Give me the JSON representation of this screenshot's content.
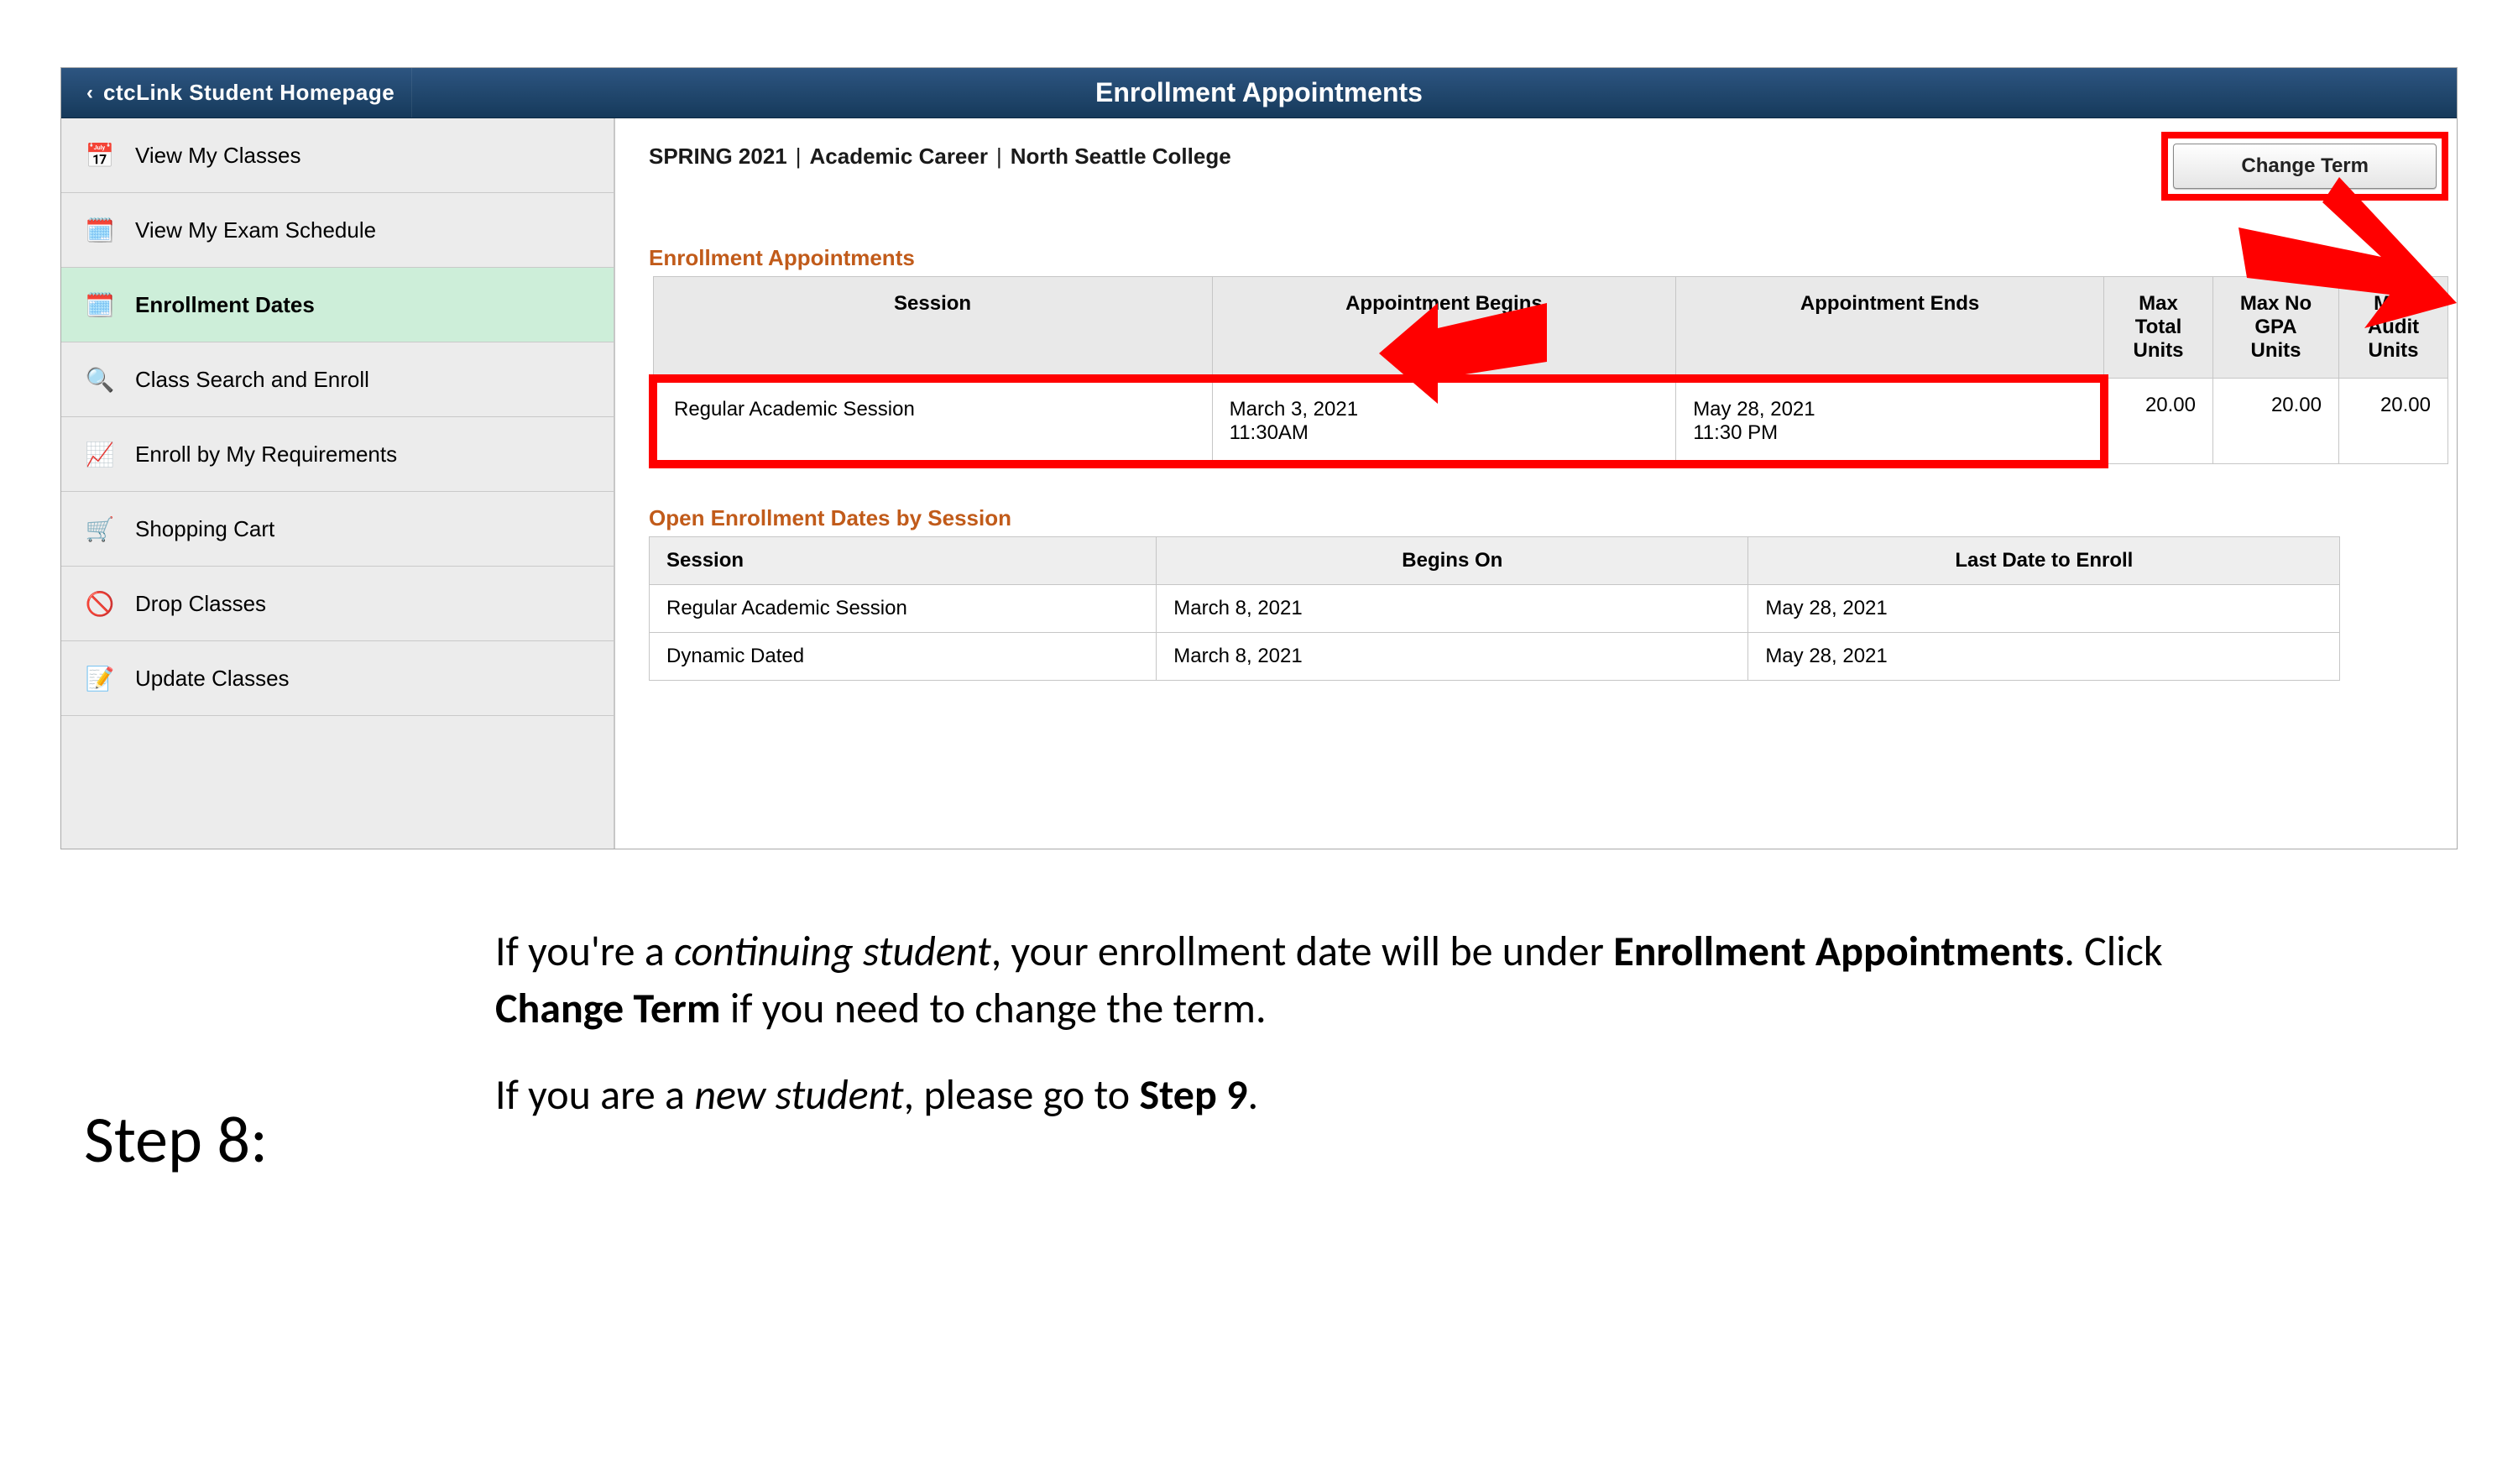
{
  "header": {
    "back_label": "ctcLink Student Homepage",
    "title": "Enrollment Appointments"
  },
  "sidebar": {
    "items": [
      {
        "label": "View My Classes",
        "icon": "📅",
        "name": "sidebar-item-view-my-classes"
      },
      {
        "label": "View My Exam Schedule",
        "icon": "🗓️",
        "name": "sidebar-item-view-my-exam-schedule"
      },
      {
        "label": "Enrollment Dates",
        "icon": "🗓️",
        "name": "sidebar-item-enrollment-dates",
        "active": true
      },
      {
        "label": "Class Search and Enroll",
        "icon": "🔍",
        "name": "sidebar-item-class-search-and-enroll"
      },
      {
        "label": "Enroll by My Requirements",
        "icon": "📈",
        "name": "sidebar-item-enroll-by-my-requirements"
      },
      {
        "label": "Shopping Cart",
        "icon": "🛒",
        "name": "sidebar-item-shopping-cart"
      },
      {
        "label": "Drop Classes",
        "icon": "🚫",
        "name": "sidebar-item-drop-classes"
      },
      {
        "label": "Update Classes",
        "icon": "📝",
        "name": "sidebar-item-update-classes"
      }
    ]
  },
  "term": {
    "code": "SPRING 2021",
    "career": "Academic Career",
    "institution": "North Seattle College",
    "change_button": "Change Term"
  },
  "enrollment_appointments": {
    "title": "Enrollment Appointments",
    "headers": {
      "session": "Session",
      "begins": "Appointment Begins",
      "ends": "Appointment Ends",
      "max_total": "Max Total Units",
      "max_no_gpa": "Max No GPA Units",
      "max_audit": "Max Audit Units"
    },
    "rows": [
      {
        "session": "Regular Academic Session",
        "begins_line1": "March 3, 2021",
        "begins_line2": "11:30AM",
        "ends_line1": "May 28, 2021",
        "ends_line2": "11:30 PM",
        "max_total": "20.00",
        "max_no_gpa": "20.00",
        "max_audit": "20.00"
      }
    ]
  },
  "open_enrollment": {
    "title": "Open Enrollment Dates by Session",
    "headers": {
      "session": "Session",
      "begins": "Begins On",
      "last": "Last Date to Enroll"
    },
    "rows": [
      {
        "session": "Regular Academic Session",
        "begins": "March 8, 2021",
        "last": "May  28, 2021"
      },
      {
        "session": "Dynamic Dated",
        "begins": "March 8, 2021",
        "last": "May  28, 2021"
      }
    ]
  },
  "caption": {
    "step": "Step 8:",
    "p1_a": "If you're a ",
    "p1_em1": "continuing student",
    "p1_b": ", your enrollment date will be under ",
    "p1_strong1": "Enrollment Appointments",
    "p1_c": ". Click ",
    "p1_strong2": "Change Term",
    "p1_d": " if you need to change the term.",
    "p2_a": "If you are a ",
    "p2_em1": "new student",
    "p2_b": ", please go to ",
    "p2_strong1": "Step 9",
    "p2_c": "."
  }
}
